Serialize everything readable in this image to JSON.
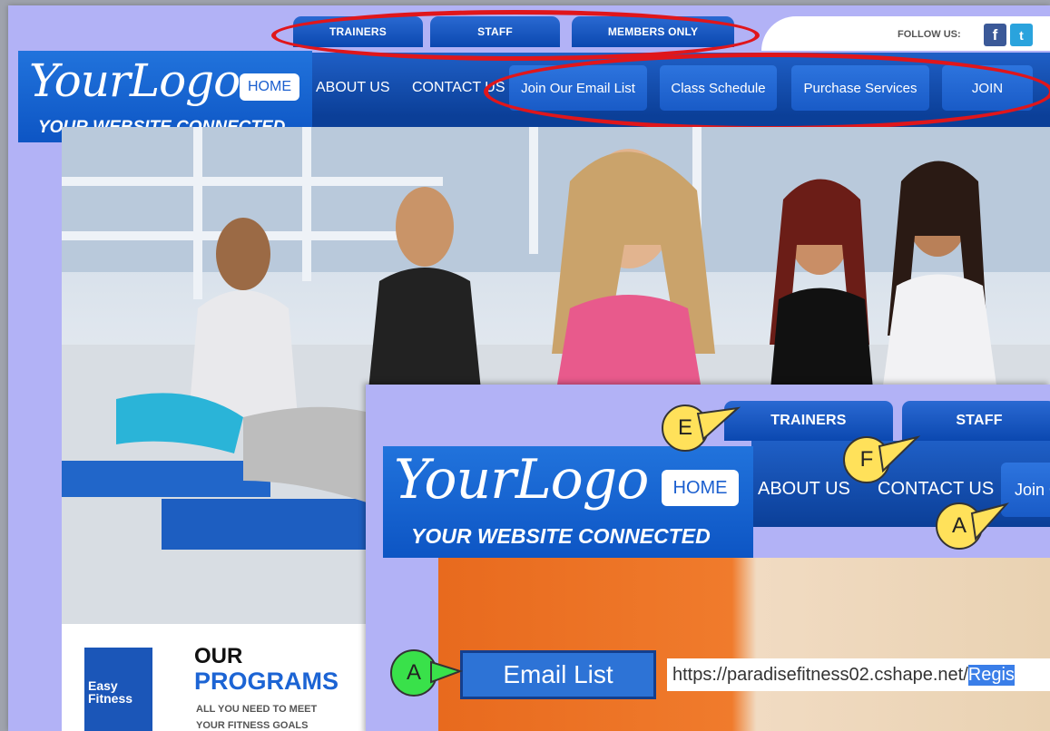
{
  "top_tabs": [
    "TRAINERS",
    "STAFF",
    "MEMBERS ONLY"
  ],
  "follow_label": "FOLLOW US:",
  "social": [
    {
      "name": "facebook",
      "glyph": "f",
      "color": "#3b5998"
    },
    {
      "name": "twitter",
      "glyph": "t",
      "color": "#2aa3dd"
    }
  ],
  "logo": {
    "main": "YourLogo",
    "tagline": "YOUR WEBSITE CONNECTED"
  },
  "nav": {
    "home": "HOME",
    "about": "ABOUT US",
    "contact": "CONTACT US"
  },
  "nav_pills": [
    "Join Our Email List",
    "Class Schedule",
    "Purchase Services",
    "JOIN"
  ],
  "programs": {
    "brand": "Easy Fitness",
    "line1": "OUR",
    "line2": "PROGRAMS",
    "sub1": "ALL YOU NEED TO MEET",
    "sub2": "YOUR FITNESS GOALS"
  },
  "inset": {
    "top_tabs": [
      "TRAINERS",
      "STAFF"
    ],
    "home": "HOME",
    "about": "ABOUT US",
    "contact": "CONTACT US",
    "join_pill": "Join O",
    "email_button": "Email List",
    "url_plain": "https://paradisefitness02.cshape.net/",
    "url_selected": "Regis",
    "callouts": [
      "E",
      "F",
      "A",
      "A"
    ]
  },
  "colors": {
    "nav_blue": "#0b48b0",
    "accent_red": "#e0161b",
    "callout_yellow": "#ffe15a",
    "callout_green": "#39e14a",
    "page_bg": "#b2b2f6"
  }
}
